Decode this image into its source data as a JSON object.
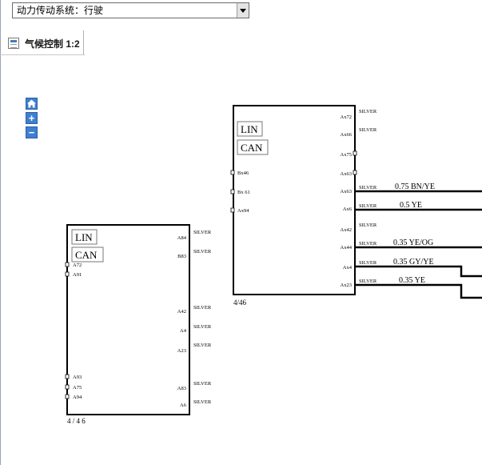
{
  "system_select": {
    "value": "动力传动系统：行驶"
  },
  "tab": {
    "title": "气候控制 1:2"
  },
  "zoom": {
    "home_icon": "home-icon",
    "zoom_in_icon": "plus-icon",
    "zoom_out_icon": "minus-icon"
  },
  "module_top": {
    "bus_labels": [
      "LIN",
      "CAN"
    ],
    "right_pins": [
      {
        "pin": "Ax72",
        "conn": "SILVER",
        "wire": ""
      },
      {
        "pin": "Ax66",
        "conn": "SILVER",
        "wire": ""
      },
      {
        "pin": "Ax75",
        "conn": "",
        "wire": ""
      },
      {
        "pin": "Ax63",
        "conn": "",
        "wire": ""
      },
      {
        "pin": "Ax63",
        "conn": "SILVER",
        "wire": "0.75 BN/YE"
      },
      {
        "pin": "Ax6",
        "conn": "SILVER",
        "wire": "0.5 YE"
      },
      {
        "pin": "Ax42",
        "conn": "SILVER",
        "wire": ""
      },
      {
        "pin": "Ax44",
        "conn": "SILVER",
        "wire": "0.35 YE/OG"
      },
      {
        "pin": "Ax4",
        "conn": "SILVER",
        "wire": "0.35 GY/YE"
      },
      {
        "pin": "Ax23",
        "conn": "SILVER",
        "wire": "0.35 YE"
      }
    ],
    "left_pins": [
      "Bx46",
      "Bx 61",
      "Ax94"
    ],
    "footer": "4/46"
  },
  "module_left": {
    "bus_labels": [
      "LIN",
      "CAN"
    ],
    "left_pins": [
      "A72",
      "A91",
      "A93",
      "A75",
      "A94"
    ],
    "right_pins": [
      {
        "pin": "A84",
        "conn": "SILVER"
      },
      {
        "pin": "B83",
        "conn": "SILVER"
      },
      {
        "pin": "A42",
        "conn": "SILVER"
      },
      {
        "pin": "A4",
        "conn": "SILVER"
      },
      {
        "pin": "A23",
        "conn": "SILVER"
      },
      {
        "pin": "A83",
        "conn": "SILVER"
      },
      {
        "pin": "A6",
        "conn": "SILVER"
      }
    ],
    "footer": "4 / 4 6"
  }
}
